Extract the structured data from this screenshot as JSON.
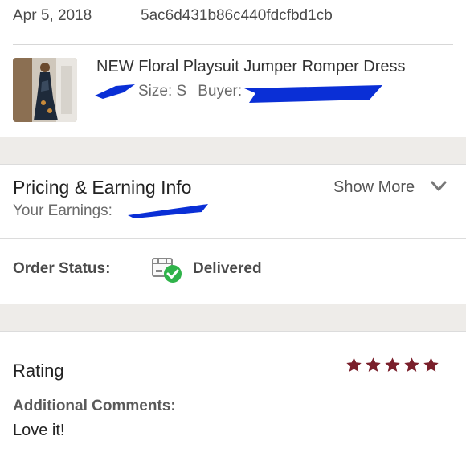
{
  "order": {
    "date": "Apr 5, 2018",
    "order_id": "5ac6d431b86c440fdcfbd1cb"
  },
  "item": {
    "title": "NEW Floral Playsuit Jumper Romper Dress",
    "size_label": "Size: S",
    "buyer_label": "Buyer:"
  },
  "pricing": {
    "title": "Pricing & Earning Info",
    "earnings_label": "Your Earnings:",
    "show_more": "Show More"
  },
  "status": {
    "label": "Order Status:",
    "value": "Delivered"
  },
  "rating": {
    "label": "Rating",
    "stars": 5,
    "star_color": "#7a1f2b",
    "comments_label": "Additional Comments:",
    "comment": "Love it!"
  },
  "icons": {
    "chevron": "chevron-down-icon",
    "status": "package-delivered-icon",
    "star": "star-icon"
  },
  "colors": {
    "redaction": "#0a2fd6",
    "check": "#2fb34a",
    "band": "#eeece9"
  }
}
